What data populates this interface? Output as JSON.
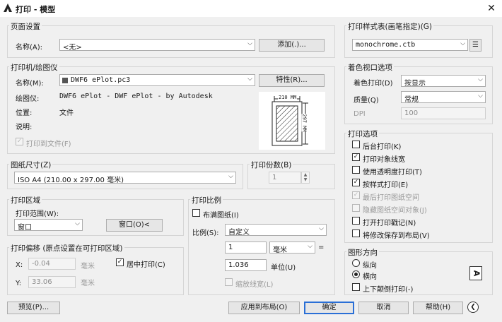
{
  "window": {
    "title": "打印 - 模型",
    "close": "✕"
  },
  "page_setup": {
    "group_label": "页面设置",
    "name_label": "名称(A):",
    "name_value": "<无>",
    "add_button": "添加(.)..."
  },
  "printer": {
    "group_label": "打印机/绘图仪",
    "name_label": "名称(M):",
    "name_value": "DWF6 ePlot.pc3",
    "properties_button": "特性(R)...",
    "plotter_label": "绘图仪:",
    "plotter_value": "DWF6 ePlot - DWF ePlot - by Autodesk",
    "location_label": "位置:",
    "location_value": "文件",
    "description_label": "说明:",
    "print_to_file": "打印到文件(F)",
    "preview_width": "210 MM",
    "preview_height": "297 MM"
  },
  "paper_size": {
    "group_label": "图纸尺寸(Z)",
    "value": "ISO A4 (210.00 x 297.00 毫米)"
  },
  "copies": {
    "group_label": "打印份数(B)",
    "value": "1"
  },
  "plot_area": {
    "group_label": "打印区域",
    "range_label": "打印范围(W):",
    "range_value": "窗口",
    "window_button": "窗口(O)<"
  },
  "plot_scale": {
    "group_label": "打印比例",
    "fit_paper": "布满图纸(I)",
    "scale_label": "比例(S):",
    "scale_value": "自定义",
    "value1": "1",
    "unit1": "毫米",
    "equals": "=",
    "value2": "1.036",
    "unit2": "单位(U)",
    "scale_lineweights": "缩放线宽(L)"
  },
  "plot_offset": {
    "group_label": "打印偏移 (原点设置在可打印区域)",
    "x_label": "X:",
    "x_value": "-0.04",
    "x_unit": "毫米",
    "y_label": "Y:",
    "y_value": "33.06",
    "y_unit": "毫米",
    "center": "居中打印(C)"
  },
  "style_table": {
    "group_label": "打印样式表(画笔指定)(G)",
    "value": "monochrome.ctb"
  },
  "shaded_viewport": {
    "group_label": "着色视口选项",
    "shade_label": "着色打印(D)",
    "shade_value": "按显示",
    "quality_label": "质量(Q)",
    "quality_value": "常规",
    "dpi_label": "DPI",
    "dpi_value": "100"
  },
  "plot_options": {
    "group_label": "打印选项",
    "items": [
      {
        "label": "后台打印(K)",
        "checked": ""
      },
      {
        "label": "打印对象线宽",
        "checked": "✓"
      },
      {
        "label": "使用透明度打印(T)",
        "checked": ""
      },
      {
        "label": "按样式打印(E)",
        "checked": "✓"
      },
      {
        "label": "最后打印图纸空间",
        "checked": "✓"
      },
      {
        "label": "隐藏图纸空间对象(J)",
        "checked": ""
      },
      {
        "label": "打开打印戳记(N)",
        "checked": ""
      },
      {
        "label": "将修改保存到布局(V)",
        "checked": ""
      }
    ]
  },
  "orientation": {
    "group_label": "图形方向",
    "portrait": "纵向",
    "landscape": "横向",
    "upside_down": "上下颠倒打印(-)",
    "preview_glyph": "A"
  },
  "footer": {
    "preview_button": "预览(P)...",
    "apply_button": "应用到布局(O)",
    "ok_button": "确定",
    "cancel_button": "取消",
    "help_button": "帮助(H)",
    "collapse_glyph": "❮"
  }
}
